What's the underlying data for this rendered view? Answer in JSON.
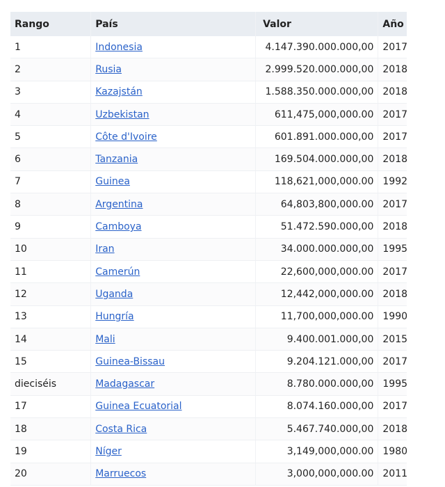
{
  "table": {
    "headers": {
      "rank": "Rango",
      "country": "País",
      "value": "Valor",
      "year": "Año"
    },
    "rows": [
      {
        "rank": "1",
        "country": "Indonesia",
        "value": "4.147.390.000.000,00",
        "year": "2017"
      },
      {
        "rank": "2",
        "country": "Rusia",
        "value": "2.999.520.000.000,00",
        "year": "2018"
      },
      {
        "rank": "3",
        "country": "Kazajstán",
        "value": "1.588.350.000.000,00",
        "year": "2018"
      },
      {
        "rank": "4",
        "country": "Uzbekistan",
        "value": "611,475,000,000.00",
        "year": "2017"
      },
      {
        "rank": "5",
        "country": "Côte d'Ivoire",
        "value": "601.891.000.000,00",
        "year": "2017"
      },
      {
        "rank": "6",
        "country": "Tanzania",
        "value": "169.504.000.000,00",
        "year": "2018"
      },
      {
        "rank": "7",
        "country": "Guinea",
        "value": "118,621,000,000.00",
        "year": "1992"
      },
      {
        "rank": "8",
        "country": "Argentina",
        "value": "64,803,800,000.00",
        "year": "2017"
      },
      {
        "rank": "9",
        "country": "Camboya",
        "value": "51.472.590.000,00",
        "year": "2018"
      },
      {
        "rank": "10",
        "country": "Iran",
        "value": "34.000.000.000,00",
        "year": "1995"
      },
      {
        "rank": "11",
        "country": "Camerún",
        "value": "22,600,000,000.00",
        "year": "2017"
      },
      {
        "rank": "12",
        "country": "Uganda",
        "value": "12,442,000,000.00",
        "year": "2018"
      },
      {
        "rank": "13",
        "country": "Hungría",
        "value": "11,700,000,000.00",
        "year": "1990"
      },
      {
        "rank": "14",
        "country": "Mali",
        "value": "9.400.001.000,00",
        "year": "2015"
      },
      {
        "rank": "15",
        "country": "Guinea-Bissau",
        "value": "9.204.121.000,00",
        "year": "2017"
      },
      {
        "rank": "dieciséis",
        "country": "Madagascar",
        "value": "8.780.000.000,00",
        "year": "1995"
      },
      {
        "rank": "17",
        "country": "Guinea Ecuatorial",
        "value": "8.074.160.000,00",
        "year": "2017"
      },
      {
        "rank": "18",
        "country": "Costa Rica",
        "value": "5.467.740.000,00",
        "year": "2018"
      },
      {
        "rank": "19",
        "country": "Níger",
        "value": "3,149,000,000.00",
        "year": "1980"
      },
      {
        "rank": "20",
        "country": "Marruecos",
        "value": "3,000,000,000.00",
        "year": "2011"
      }
    ]
  }
}
